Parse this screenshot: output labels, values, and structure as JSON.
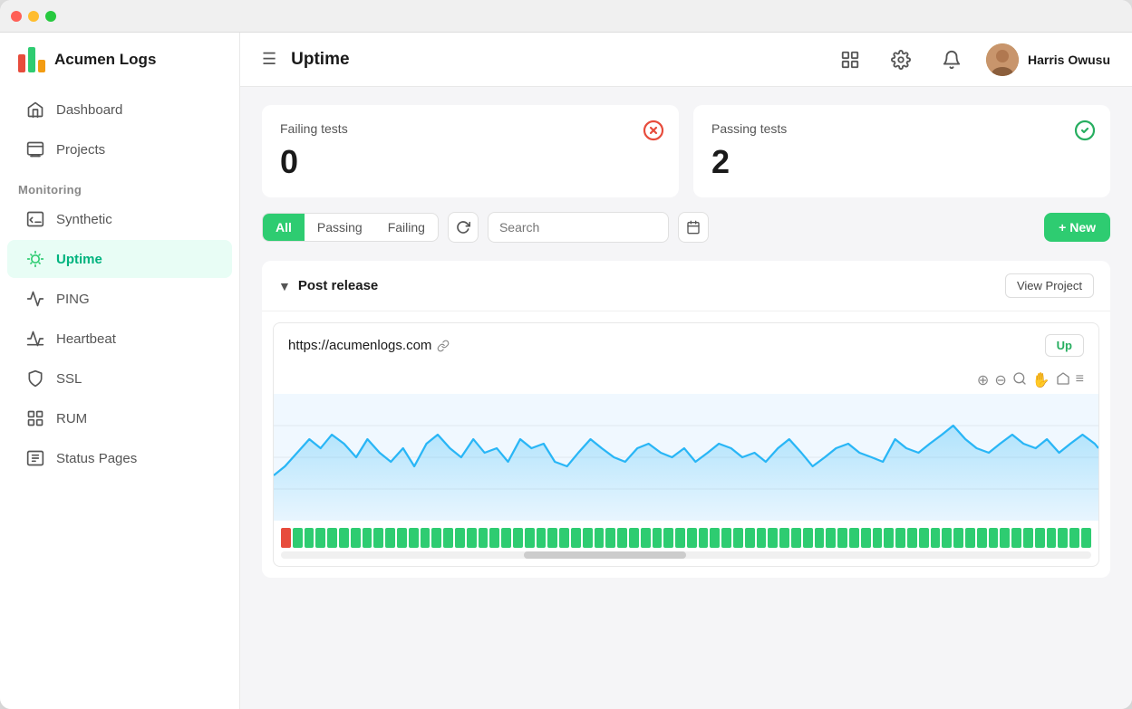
{
  "window": {
    "dots": [
      "red",
      "yellow",
      "green"
    ]
  },
  "sidebar": {
    "logo_text": "Acumen Logs",
    "nav_items": [
      {
        "id": "dashboard",
        "label": "Dashboard",
        "icon": "home"
      },
      {
        "id": "projects",
        "label": "Projects",
        "icon": "chart"
      }
    ],
    "monitoring_label": "Monitoring",
    "monitoring_items": [
      {
        "id": "synthetic",
        "label": "Synthetic",
        "icon": "terminal",
        "active": false
      },
      {
        "id": "uptime",
        "label": "Uptime",
        "icon": "uptime",
        "active": true
      },
      {
        "id": "ping",
        "label": "PING",
        "icon": "inbox"
      },
      {
        "id": "heartbeat",
        "label": "Heartbeat",
        "icon": "wave"
      },
      {
        "id": "ssl",
        "label": "SSL",
        "icon": "shield"
      },
      {
        "id": "rum",
        "label": "RUM",
        "icon": "rum"
      },
      {
        "id": "status-pages",
        "label": "Status Pages",
        "icon": "status"
      }
    ]
  },
  "topbar": {
    "title": "Uptime",
    "user_name": "Harris Owusu"
  },
  "stats": {
    "failing": {
      "label": "Failing tests",
      "value": "0"
    },
    "passing": {
      "label": "Passing tests",
      "value": "2"
    }
  },
  "filters": {
    "tabs": [
      "All",
      "Passing",
      "Failing"
    ],
    "active_tab": "All",
    "search_placeholder": "Search",
    "new_button_label": "+ New"
  },
  "project": {
    "name": "Post release",
    "view_project_label": "View Project",
    "monitor": {
      "url": "https://acumenlogs.com",
      "status": "Up",
      "status_bars": [
        "red",
        "green",
        "green",
        "green",
        "green",
        "green",
        "green",
        "green",
        "green",
        "green",
        "green",
        "green",
        "green",
        "green",
        "green",
        "green",
        "green",
        "green",
        "green",
        "green",
        "green",
        "green",
        "green",
        "green",
        "green",
        "green",
        "green",
        "green",
        "green",
        "green",
        "green",
        "green",
        "green",
        "green",
        "green",
        "green",
        "green",
        "green",
        "green",
        "green",
        "green",
        "green",
        "green",
        "green",
        "green",
        "green",
        "green",
        "green",
        "green",
        "green",
        "green",
        "green",
        "green",
        "green",
        "green",
        "green",
        "green",
        "green",
        "green",
        "green",
        "green",
        "green",
        "green",
        "green",
        "green",
        "green",
        "green",
        "green",
        "green",
        "green"
      ]
    }
  }
}
